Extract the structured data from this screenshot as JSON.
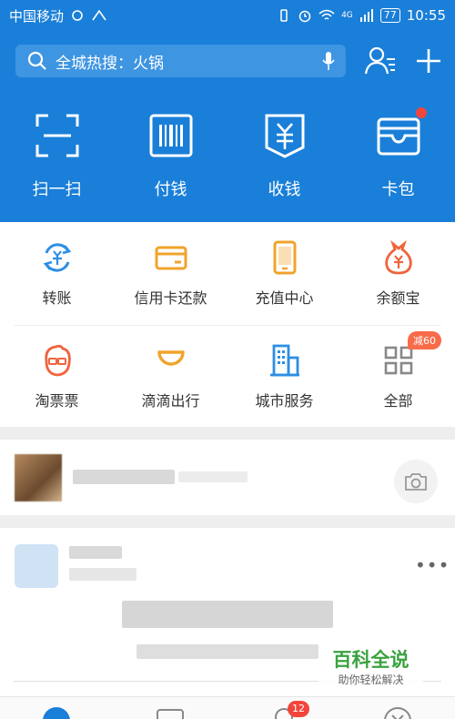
{
  "statusbar": {
    "carrier": "中国移动",
    "network": "4G",
    "battery": "77",
    "time": "10:55"
  },
  "search": {
    "placeholder": "全城热搜：火锅"
  },
  "big_actions": [
    {
      "label": "扫一扫",
      "icon": "scan-icon"
    },
    {
      "label": "付钱",
      "icon": "barcode-icon"
    },
    {
      "label": "收钱",
      "icon": "receive-money-icon"
    },
    {
      "label": "卡包",
      "icon": "wallet-icon"
    }
  ],
  "grid_row1": [
    {
      "label": "转账",
      "icon": "transfer-icon",
      "color": "#2d8fe3"
    },
    {
      "label": "信用卡还款",
      "icon": "credit-card-icon",
      "color": "#f0a32b"
    },
    {
      "label": "充值中心",
      "icon": "phone-topup-icon",
      "color": "#f0a32b"
    },
    {
      "label": "余额宝",
      "icon": "money-bag-icon",
      "color": "#f0643c"
    }
  ],
  "grid_row2": [
    {
      "label": "淘票票",
      "icon": "ticket-mascot-icon",
      "color": "#f0643c"
    },
    {
      "label": "滴滴出行",
      "icon": "didi-icon",
      "color": "#f0a32b"
    },
    {
      "label": "城市服务",
      "icon": "city-building-icon",
      "color": "#2d8fe3"
    },
    {
      "label": "全部",
      "icon": "grid-all-icon",
      "color": "#888888"
    }
  ],
  "badges": {
    "all_discount": "减60",
    "friends_count": "12"
  },
  "watermark": {
    "title": "百科全说",
    "subtitle": "助你轻松解决"
  },
  "colors": {
    "brand_blue": "#1a7fd8",
    "badge_red": "#f2463c"
  }
}
